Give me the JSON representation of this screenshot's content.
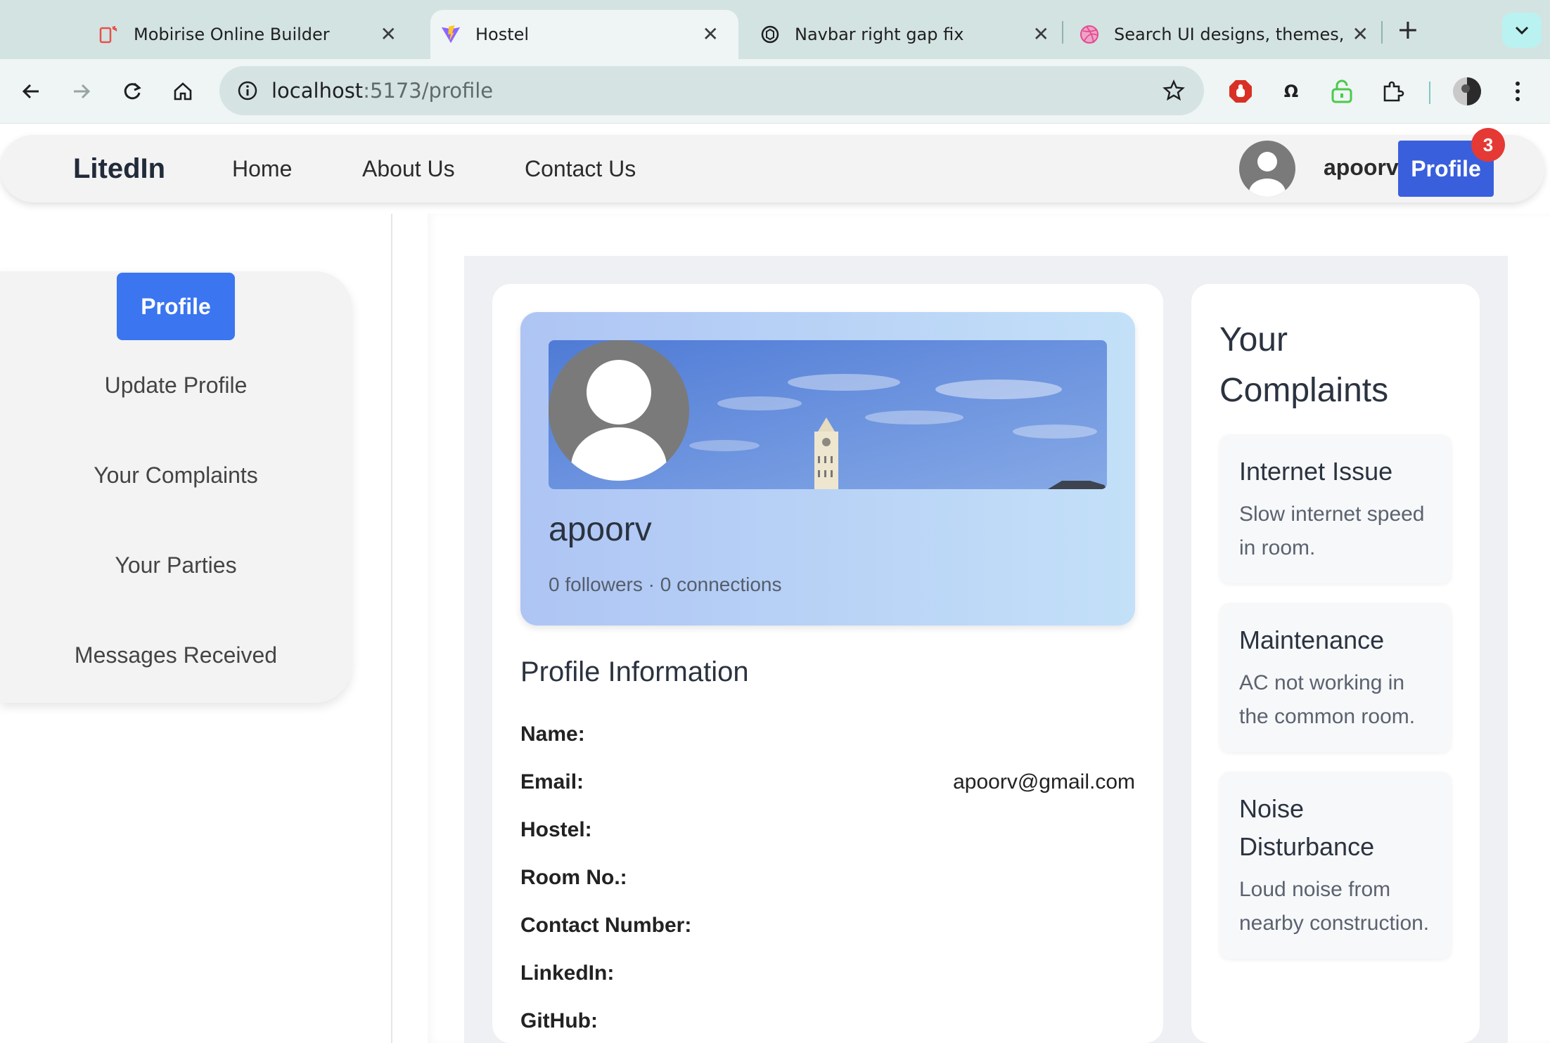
{
  "browser": {
    "tabs": [
      {
        "title": "Mobirise Online Builder",
        "active": false,
        "icon": "mobirise-icon"
      },
      {
        "title": "Hostel",
        "active": true,
        "icon": "vite-icon"
      },
      {
        "title": "Navbar right gap fix",
        "active": false,
        "icon": "chatgpt-icon"
      },
      {
        "title": "Search UI designs, themes,",
        "active": false,
        "icon": "dribbble-icon"
      }
    ],
    "url_host": "localhost",
    "url_path": ":5173/profile"
  },
  "navbar": {
    "brand": "LitedIn",
    "links": [
      "Home",
      "About Us",
      "Contact Us"
    ],
    "username": "apoorv",
    "profile_button": "Profile",
    "notification_count": "3"
  },
  "sidebar": {
    "active": "Profile",
    "items": [
      "Update Profile",
      "Your Complaints",
      "Your Parties",
      "Messages Received"
    ]
  },
  "profile": {
    "name": "apoorv",
    "stats": "0 followers · 0 connections",
    "info_title": "Profile Information",
    "fields": [
      {
        "label": "Name:",
        "value": ""
      },
      {
        "label": "Email:",
        "value": "apoorv@gmail.com"
      },
      {
        "label": "Hostel:",
        "value": ""
      },
      {
        "label": "Room No.:",
        "value": ""
      },
      {
        "label": "Contact Number:",
        "value": ""
      },
      {
        "label": "LinkedIn:",
        "value": ""
      },
      {
        "label": "GitHub:",
        "value": ""
      }
    ]
  },
  "complaints": {
    "title": "Your Complaints",
    "items": [
      {
        "title": "Internet Issue",
        "description": "Slow internet speed in room."
      },
      {
        "title": "Maintenance",
        "description": "AC not working in the common room."
      },
      {
        "title": "Noise Disturbance",
        "description": "Loud noise from nearby construction."
      }
    ]
  },
  "colors": {
    "primary": "#3b75f0",
    "nav_button": "#3a5fdc",
    "badge": "#e53935",
    "tabbar": "#d3e3e2"
  }
}
